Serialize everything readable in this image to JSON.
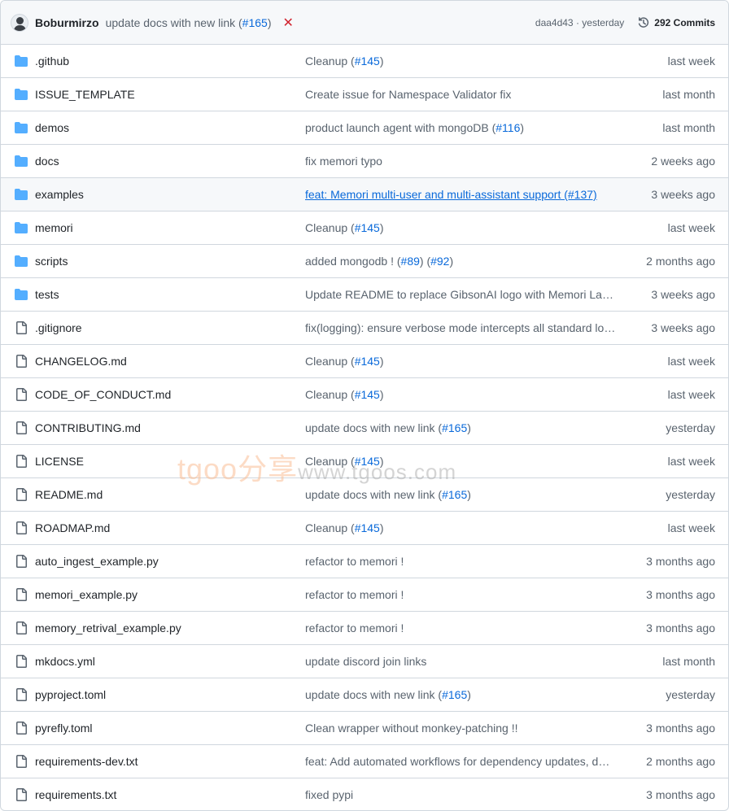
{
  "header": {
    "author": "Boburmirzo",
    "commit_message": "update docs with new link (",
    "commit_pr": "#165",
    "commit_close": ")",
    "status_icon": "x-icon",
    "status_symbol": "✕",
    "status_color": "#d1242f",
    "sha_and_time": "daa4d43 · yesterday",
    "commits_label": "292 Commits"
  },
  "files": [
    {
      "type": "folder",
      "name": ".github",
      "msg": "Cleanup (#145)",
      "date": "last week"
    },
    {
      "type": "folder",
      "name": "ISSUE_TEMPLATE",
      "msg": "Create issue for Namespace Validator fix",
      "date": "last month"
    },
    {
      "type": "folder",
      "name": "demos",
      "msg": "product launch agent with mongoDB (#116)",
      "date": "last month"
    },
    {
      "type": "folder",
      "name": "docs",
      "msg": "fix memori typo",
      "date": "2 weeks ago"
    },
    {
      "type": "folder",
      "name": "examples",
      "msg": "feat: Memori multi-user and multi-assistant support (#137)",
      "date": "3 weeks ago"
    },
    {
      "type": "folder",
      "name": "memori",
      "msg": "Cleanup (#145)",
      "date": "last week"
    },
    {
      "type": "folder",
      "name": "scripts",
      "msg": "added mongodb ! (#89) (#92)",
      "date": "2 months ago"
    },
    {
      "type": "folder",
      "name": "tests",
      "msg": "Update README to replace GibsonAI logo with Memori Labs logo",
      "date": "3 weeks ago"
    },
    {
      "type": "file",
      "name": ".gitignore",
      "msg": "fix(logging): ensure verbose mode intercepts all standard logs",
      "date": "3 weeks ago"
    },
    {
      "type": "file",
      "name": "CHANGELOG.md",
      "msg": "Cleanup (#145)",
      "date": "last week"
    },
    {
      "type": "file",
      "name": "CODE_OF_CONDUCT.md",
      "msg": "Cleanup (#145)",
      "date": "last week"
    },
    {
      "type": "file",
      "name": "CONTRIBUTING.md",
      "msg": "update docs with new link (#165)",
      "date": "yesterday"
    },
    {
      "type": "file",
      "name": "LICENSE",
      "msg": "Cleanup (#145)",
      "date": "last week"
    },
    {
      "type": "file",
      "name": "README.md",
      "msg": "update docs with new link (#165)",
      "date": "yesterday"
    },
    {
      "type": "file",
      "name": "ROADMAP.md",
      "msg": "Cleanup (#145)",
      "date": "last week"
    },
    {
      "type": "file",
      "name": "auto_ingest_example.py",
      "msg": "refactor to memori !",
      "date": "3 months ago"
    },
    {
      "type": "file",
      "name": "memori_example.py",
      "msg": "refactor to memori !",
      "date": "3 months ago"
    },
    {
      "type": "file",
      "name": "memory_retrival_example.py",
      "msg": "refactor to memori !",
      "date": "3 months ago"
    },
    {
      "type": "file",
      "name": "mkdocs.yml",
      "msg": "update discord join links",
      "date": "last month"
    },
    {
      "type": "file",
      "name": "pyproject.toml",
      "msg": "update docs with new link (#165)",
      "date": "yesterday"
    },
    {
      "type": "file",
      "name": "pyrefly.toml",
      "msg": "Clean wrapper without monkey-patching !!",
      "date": "3 months ago"
    },
    {
      "type": "file",
      "name": "requirements-dev.txt",
      "msg": "feat: Add automated workflows for dependency updates, docs",
      "date": "2 months ago"
    },
    {
      "type": "file",
      "name": "requirements.txt",
      "msg": "fixed pypi",
      "date": "3 months ago"
    }
  ],
  "hovered_row": "examples",
  "watermark": {
    "left": "tgoo分享",
    "right": "www.tgoos.com"
  },
  "colors": {
    "folder": "#54aeff",
    "file": "#59636e",
    "link": "#0969da",
    "muted": "#59636e",
    "border": "#d0d7de",
    "header_bg": "#f6f8fa"
  }
}
